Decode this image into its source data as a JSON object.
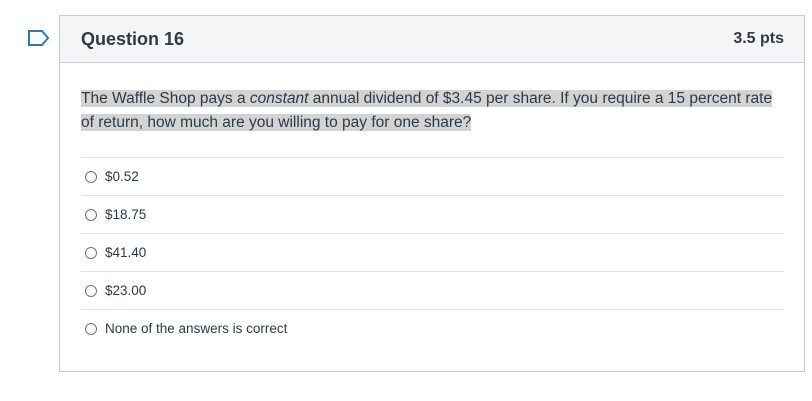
{
  "flag": {
    "icon": "bookmark-flag-icon",
    "color": "#2b7abc"
  },
  "question": {
    "title": "Question 16",
    "points": "3.5 pts",
    "text_before": "The Waffle Shop pays a ",
    "text_emphasis": "constant",
    "text_after": " annual dividend of $3.45 per share. If you require a 15 percent rate of return, how much are you willing to pay for one share?",
    "highlight_color": "#d3d3d3",
    "answers": [
      {
        "label": "$0.52",
        "selected": false
      },
      {
        "label": "$18.75",
        "selected": false
      },
      {
        "label": "$41.40",
        "selected": false
      },
      {
        "label": "$23.00",
        "selected": false
      },
      {
        "label": "None of the answers is correct",
        "selected": false
      }
    ]
  }
}
